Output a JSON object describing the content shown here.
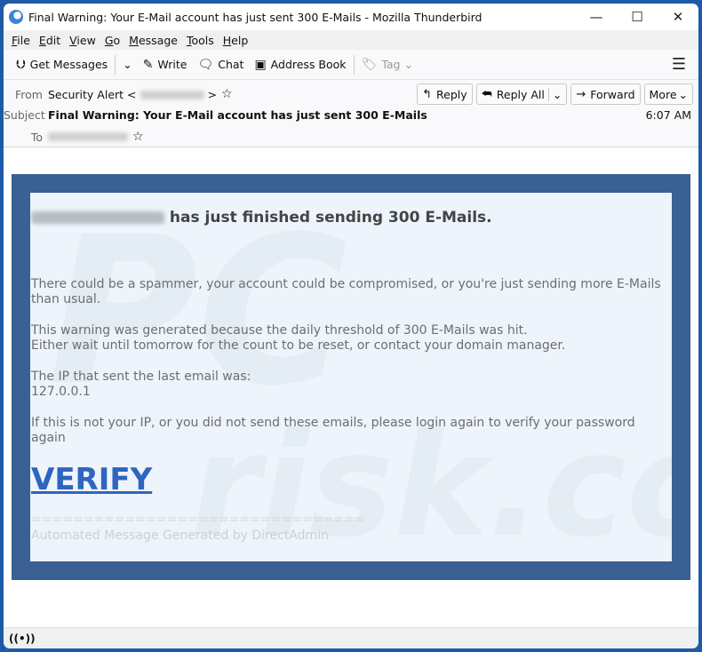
{
  "window": {
    "title": "Final Warning: Your E-Mail account has just sent 300 E-Mails - Mozilla Thunderbird",
    "controls": {
      "minimize": "—",
      "maximize": "☐",
      "close": "✕"
    }
  },
  "menubar": {
    "items": [
      {
        "key": "F",
        "rest": "ile"
      },
      {
        "key": "E",
        "rest": "dit"
      },
      {
        "key": "V",
        "rest": "iew"
      },
      {
        "key": "G",
        "rest": "o"
      },
      {
        "key": "M",
        "rest": "essage"
      },
      {
        "key": "T",
        "rest": "ools"
      },
      {
        "key": "H",
        "rest": "elp"
      }
    ]
  },
  "toolbar": {
    "get_messages": "Get Messages",
    "write": "Write",
    "chat": "Chat",
    "address_book": "Address Book",
    "tag": "Tag"
  },
  "header": {
    "from_label": "From",
    "from_name": "Security Alert <",
    "from_close": ">",
    "subject_label": "Subject",
    "subject": "Final Warning: Your E-Mail account has just sent 300 E-Mails",
    "to_label": "To",
    "time": "6:07 AM",
    "actions": {
      "reply": "Reply",
      "reply_all": "Reply All",
      "forward": "Forward",
      "more": "More"
    }
  },
  "email": {
    "headline": "has just finished sending 300 E-Mails.",
    "p1": "There could be a spammer, your account could be compromised, or you're just sending more E-Mails than usual.",
    "p2a": "This warning was generated because the daily threshold of 300 E-Mails was hit.",
    "p2b": "Either wait until tomorrow for the count to be reset, or contact your domain manager.",
    "p3a": "The IP that sent the last email was:",
    "p3b": "127.0.0.1",
    "p4": "If this is not your IP, or you did not send these emails, please login again to verify your password again",
    "verify": "VERIFY",
    "separator": "================================",
    "footer": "Automated Message Generated by DirectAdmin",
    "watermark": "PC risk.com"
  },
  "colors": {
    "frame": "#3a6094",
    "panel": "#eef4fb",
    "link": "#2e65c0"
  }
}
